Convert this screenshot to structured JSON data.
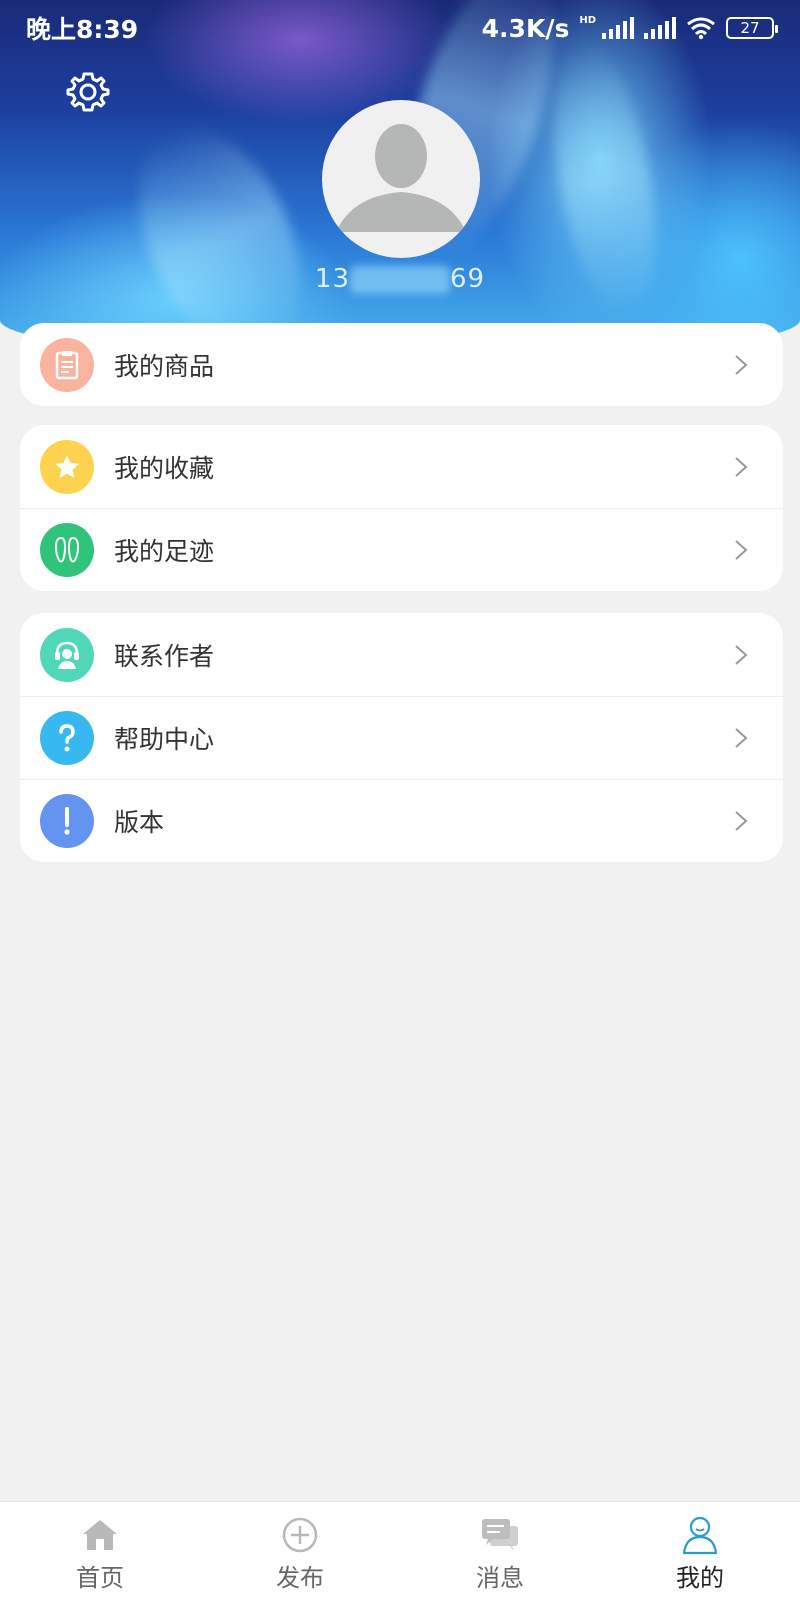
{
  "status_bar": {
    "time": "晚上8:39",
    "speed": "4.3K/s",
    "network_badge": "HD",
    "battery": "27"
  },
  "profile": {
    "phone_prefix": "13",
    "phone_suffix": "69"
  },
  "menu_groups": [
    [
      {
        "label": "我的商品",
        "icon": "clipboard-icon",
        "color": "#f9b39f"
      }
    ],
    [
      {
        "label": "我的收藏",
        "icon": "star-icon",
        "color": "#fcd24e"
      },
      {
        "label": "我的足迹",
        "icon": "footprint-icon",
        "color": "#2fc479"
      }
    ],
    [
      {
        "label": "联系作者",
        "icon": "headset-icon",
        "color": "#4fd7b8"
      },
      {
        "label": "帮助中心",
        "icon": "question-icon",
        "color": "#37b8ef"
      },
      {
        "label": "版本",
        "icon": "exclamation-icon",
        "color": "#6394ef"
      }
    ]
  ],
  "tabs": [
    {
      "label": "首页",
      "icon": "home-icon"
    },
    {
      "label": "发布",
      "icon": "plus-circle-icon"
    },
    {
      "label": "消息",
      "icon": "chat-icon"
    },
    {
      "label": "我的",
      "icon": "person-icon",
      "active": true
    }
  ],
  "colors": {
    "background": "#f1f1f1",
    "active_tab_icon": "#2a9bd0"
  }
}
